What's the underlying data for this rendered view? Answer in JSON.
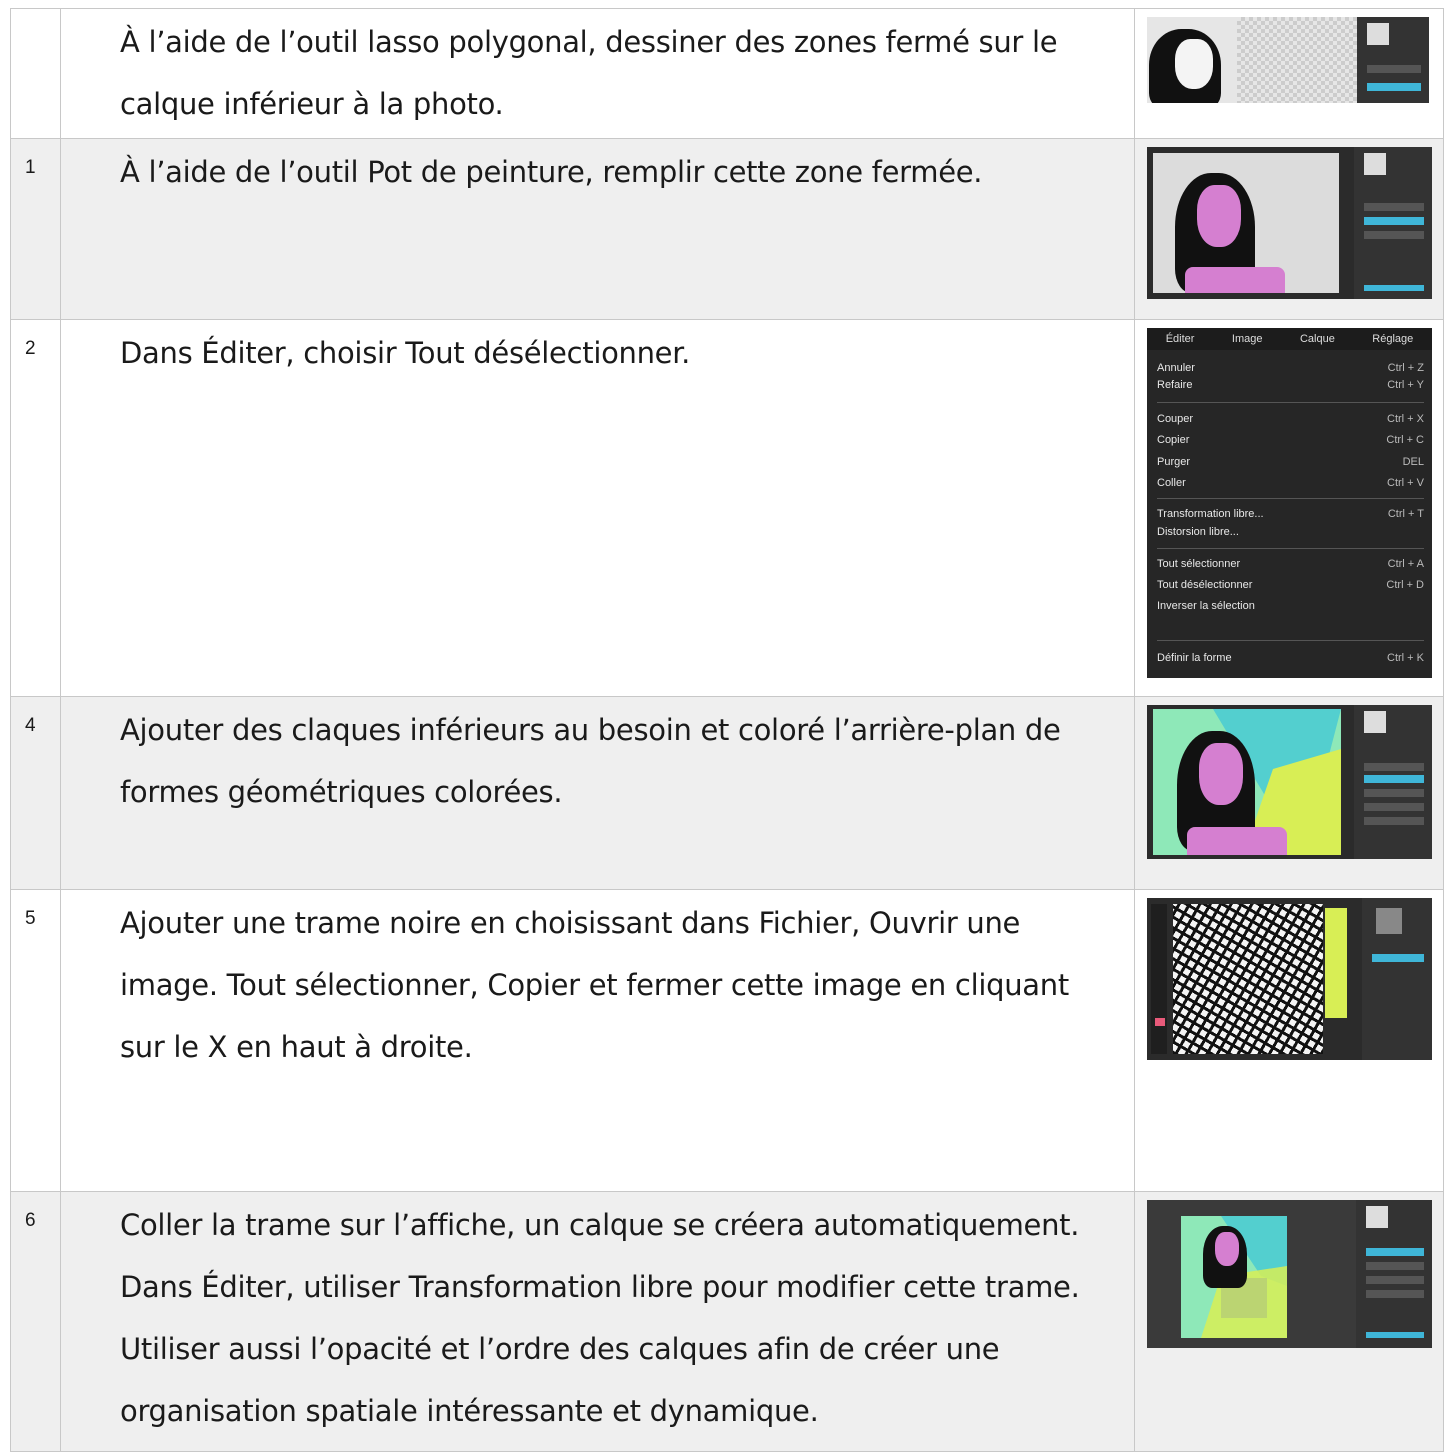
{
  "rows": [
    {
      "num": "",
      "text": "À l’aide de l’outil lasso polygonal, dessiner des zones fermé sur le calque inférieur à la photo."
    },
    {
      "num": "1",
      "text": "À l’aide de l’outil Pot de peinture, remplir cette zone fermée."
    },
    {
      "num": "2",
      "text": "Dans Éditer, choisir Tout désélectionner."
    },
    {
      "num": "4",
      "text": "Ajouter des claques inférieurs au besoin et coloré l’arrière-plan de formes géométriques colorées."
    },
    {
      "num": "5",
      "text": "Ajouter une trame noire en choisissant dans Fichier, Ouvrir une image. Tout sélectionner, Copier et fermer cette image en cliquant sur le X en haut à droite."
    },
    {
      "num": "6",
      "text": "Coller la trame sur l’affiche, un calque se créera automatiquement. Dans Éditer, utiliser Transformation libre pour modifier cette trame. Utiliser aussi l’opacité et l’ordre des calques afin de créer une organisation spatiale intéressante et dynamique."
    }
  ],
  "edit_menu": {
    "headers": [
      "Éditer",
      "Image",
      "Calque",
      "Réglage"
    ],
    "items": [
      {
        "label": "Annuler",
        "shortcut": "Ctrl + Z"
      },
      {
        "label": "Refaire",
        "shortcut": "Ctrl + Y"
      },
      {
        "label": "Couper",
        "shortcut": "Ctrl + X"
      },
      {
        "label": "Copier",
        "shortcut": "Ctrl + C"
      },
      {
        "label": "Purger",
        "shortcut": "DEL"
      },
      {
        "label": "Coller",
        "shortcut": "Ctrl + V"
      },
      {
        "label": "Transformation libre...",
        "shortcut": "Ctrl + T"
      },
      {
        "label": "Distorsion libre...",
        "shortcut": ""
      },
      {
        "label": "Tout sélectionner",
        "shortcut": "Ctrl + A"
      },
      {
        "label": "Tout désélectionner",
        "shortcut": "Ctrl + D"
      },
      {
        "label": "Inverser la sélection",
        "shortcut": ""
      },
      {
        "label": "Définir la forme",
        "shortcut": "Ctrl + K"
      }
    ]
  },
  "colors": {
    "pink": "#d57fd0",
    "cyan": "#53cfcf",
    "mint": "#8ee8b8",
    "yellow": "#d8ee55",
    "active_layer": "#3fb6d8"
  }
}
